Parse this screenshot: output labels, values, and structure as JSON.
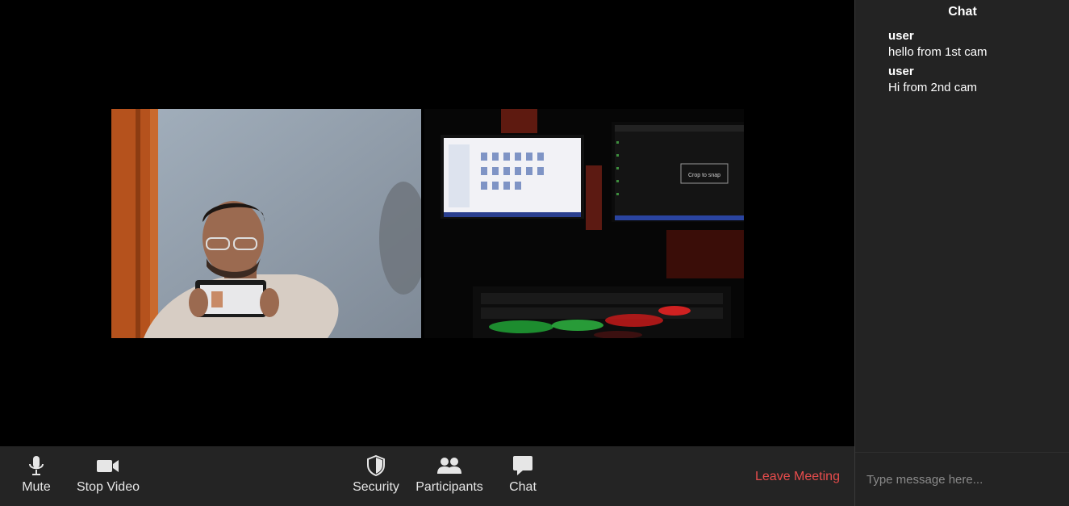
{
  "toolbar": {
    "mute_label": "Mute",
    "stop_video_label": "Stop Video",
    "security_label": "Security",
    "participants_label": "Participants",
    "chat_label": "Chat",
    "leave_label": "Leave Meeting",
    "icons": {
      "mute": "microphone-icon",
      "video": "video-camera-icon",
      "security": "shield-icon",
      "participants": "people-icon",
      "chat": "speech-bubble-icon"
    },
    "leave_color": "#e74c4c"
  },
  "chat": {
    "title": "Chat",
    "messages": [
      {
        "author": "user",
        "text": "hello from 1st cam"
      },
      {
        "author": "user",
        "text": "Hi from 2nd cam"
      }
    ],
    "input_placeholder": "Type message here..."
  },
  "videos": {
    "tile_2_overlay_text": "Crop to snap"
  }
}
